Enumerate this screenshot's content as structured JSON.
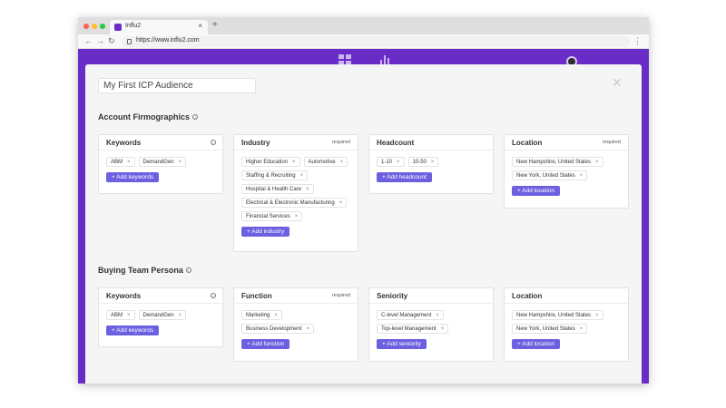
{
  "browser": {
    "tab_title": "Influ2",
    "tab_close": "×",
    "new_tab": "+",
    "url": "https://www.influ2.com",
    "colors": {
      "close": "#ff5f56",
      "minimize": "#ffbd2e",
      "maximize": "#27c93f"
    }
  },
  "modal": {
    "audience_name": "My First ICP Audience",
    "close": "×"
  },
  "sections": [
    {
      "title": "Account Firmographics",
      "cards": [
        {
          "title": "Keywords",
          "info": "i",
          "required": "",
          "chips": [
            "ABM",
            "DemandGen"
          ],
          "add_label": "+ Add keywords"
        },
        {
          "title": "Industry",
          "info": "",
          "required": "required",
          "chips": [
            "Higher Education",
            "Automotive",
            "Staffing & Recruiting",
            "Hospital & Health Care",
            "Electrical & Electronic Manufacturing",
            "Financial Services"
          ],
          "add_label": "+ Add industry"
        },
        {
          "title": "Headcount",
          "info": "",
          "required": "",
          "chips": [
            "1-10",
            "10-50"
          ],
          "add_label": "+ Add headcount"
        },
        {
          "title": "Location",
          "info": "",
          "required": "required",
          "chips": [
            "New Hampshire, United States",
            "New York, United States"
          ],
          "add_label": "+ Add location"
        }
      ]
    },
    {
      "title": "Buying Team Persona",
      "cards": [
        {
          "title": "Keywords",
          "info": "i",
          "required": "",
          "chips": [
            "ABM",
            "DemandGen"
          ],
          "add_label": "+ Add keywords"
        },
        {
          "title": "Function",
          "info": "",
          "required": "required",
          "chips": [
            "Marketing",
            "Business Development"
          ],
          "add_label": "+ Add function"
        },
        {
          "title": "Seniority",
          "info": "",
          "required": "",
          "chips": [
            "C-level Management",
            "Top-level Management"
          ],
          "add_label": "+ Add seniority"
        },
        {
          "title": "Location",
          "info": "",
          "required": "",
          "chips": [
            "New Hampshire, United States",
            "New York, United States"
          ],
          "add_label": "+ Add location"
        }
      ]
    }
  ],
  "chip_remove": "×",
  "colors": {
    "brand": "#6a2cc7",
    "button": "#6c60e0"
  }
}
